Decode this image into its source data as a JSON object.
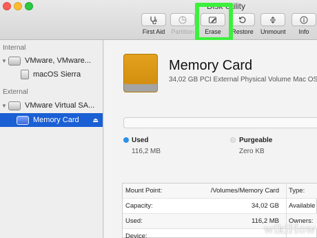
{
  "window": {
    "title": "Disk Utility"
  },
  "toolbar": {
    "buttons": [
      {
        "label": "First Aid",
        "icon": "stethoscope-icon",
        "enabled": true
      },
      {
        "label": "Partition",
        "icon": "pie-chart-icon",
        "enabled": false
      },
      {
        "label": "Erase",
        "icon": "erase-icon",
        "enabled": true
      },
      {
        "label": "Restore",
        "icon": "restore-icon",
        "enabled": true
      },
      {
        "label": "Unmount",
        "icon": "unmount-icon",
        "enabled": true
      },
      {
        "label": "Info",
        "icon": "info-icon",
        "enabled": true
      }
    ],
    "highlight_color": "#3cf03c"
  },
  "sidebar": {
    "internal_header": "Internal",
    "external_header": "External",
    "items": [
      {
        "label": "VMware, VMware..."
      },
      {
        "label": "macOS Sierra"
      },
      {
        "label": "VMware Virtual SA..."
      },
      {
        "label": "Memory Card",
        "selected": true,
        "eject": "⏏"
      }
    ]
  },
  "detail": {
    "title": "Memory Card",
    "subtitle": "34,02 GB PCI External Physical Volume Mac OS",
    "used_label": "Used",
    "used_value": "116,2 MB",
    "used_color": "#2b90e8",
    "purgeable_label": "Purgeable",
    "purgeable_value": "Zero KB",
    "info": [
      {
        "key": "Mount Point:",
        "value": "/Volumes/Memory Card",
        "key2": "Type:"
      },
      {
        "key": "Capacity:",
        "value": "34,02 GB",
        "key2": "Available (P"
      },
      {
        "key": "Used:",
        "value": "116,2 MB",
        "key2": "Owners:"
      },
      {
        "key": "Device:",
        "value": "",
        "key2": ""
      }
    ]
  },
  "watermark": "wikiHow"
}
